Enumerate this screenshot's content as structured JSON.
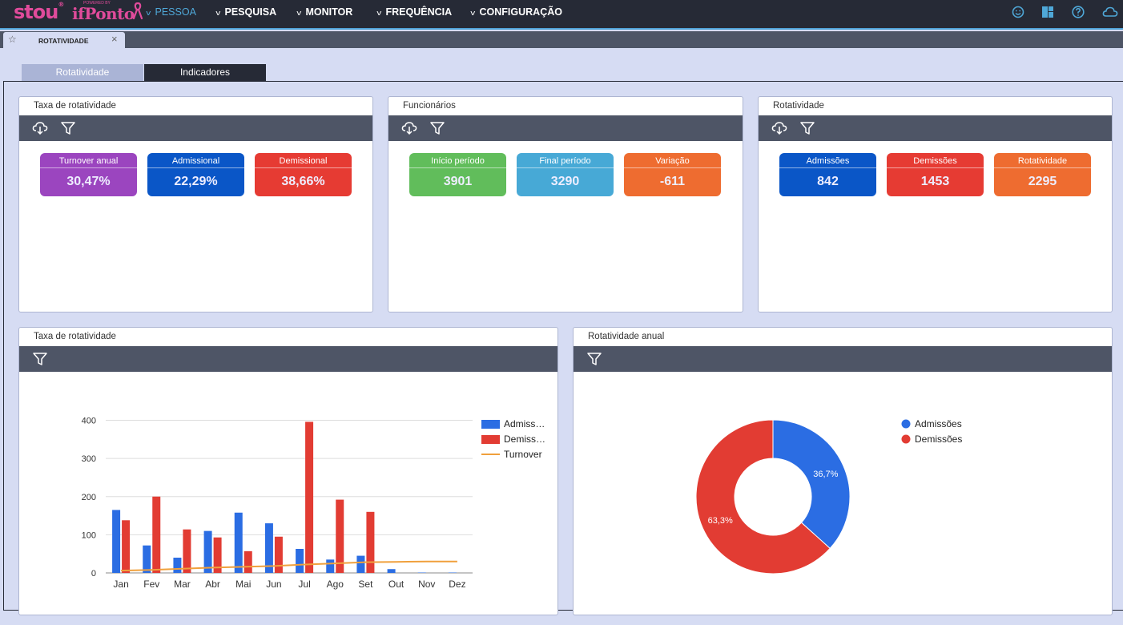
{
  "topbar": {
    "logo_main": "stou",
    "logo_sup": "®",
    "logo_powered": "POWERED BY",
    "logo_secondary": "ifPonto",
    "nav": [
      {
        "label": "PESSOA",
        "active": true
      },
      {
        "label": "PESQUISA"
      },
      {
        "label": "MONITOR"
      },
      {
        "label": "FREQUÊNCIA"
      },
      {
        "label": "CONFIGURAÇÃO"
      }
    ],
    "right_icons": [
      "smiley-icon",
      "dashboard-icon",
      "help-icon",
      "cloud-icon"
    ]
  },
  "tabs": [
    {
      "label": "ROTATIVIDADE",
      "star_icon": "star-icon",
      "close_icon": "close-icon"
    }
  ],
  "subtabs": [
    {
      "label": "Rotatividade"
    },
    {
      "label": "Indicadores",
      "active": true
    }
  ],
  "panels": {
    "taxa": {
      "title": "Taxa de rotatividade",
      "cards": [
        {
          "label": "Turnover anual",
          "value": "30,47%"
        },
        {
          "label": "Admissional",
          "value": "22,29%"
        },
        {
          "label": "Demissional",
          "value": "38,66%"
        }
      ]
    },
    "funcionarios": {
      "title": "Funcionários",
      "cards": [
        {
          "label": "Início período",
          "value": "3901"
        },
        {
          "label": "Final período",
          "value": "3290"
        },
        {
          "label": "Variação",
          "value": "-611"
        }
      ]
    },
    "rotatividade": {
      "title": "Rotatividade",
      "cards": [
        {
          "label": "Admissões",
          "value": "842"
        },
        {
          "label": "Demissões",
          "value": "1453"
        },
        {
          "label": "Rotatividade",
          "value": "2295"
        }
      ]
    },
    "chart1": {
      "title": "Taxa de rotatividade"
    },
    "chart2": {
      "title": "Rotatividade anual"
    }
  },
  "colors": {
    "admissoes": "#2b6de3",
    "demissoes": "#e23c33",
    "turnover": "#f0a03c",
    "toolbar": "#4e5566",
    "topbar": "#262a36"
  },
  "chart_data": [
    {
      "type": "bar",
      "categories": [
        "Jan",
        "Fev",
        "Mar",
        "Abr",
        "Mai",
        "Jun",
        "Jul",
        "Ago",
        "Set",
        "Out",
        "Nov",
        "Dez"
      ],
      "series": [
        {
          "name": "Admiss…",
          "type": "bar",
          "values": [
            165,
            72,
            40,
            110,
            158,
            130,
            63,
            35,
            45,
            10,
            1,
            1
          ]
        },
        {
          "name": "Demiss…",
          "type": "bar",
          "values": [
            138,
            200,
            114,
            93,
            57,
            95,
            396,
            192,
            160,
            0,
            0,
            0
          ]
        },
        {
          "name": "Turnover",
          "type": "line",
          "values": [
            6,
            8,
            11,
            14,
            16,
            18,
            22,
            25,
            28,
            29,
            30,
            30
          ]
        }
      ],
      "y_ticks": [
        0,
        100,
        200,
        300,
        400
      ],
      "ylim": [
        0,
        420
      ],
      "grid": true,
      "legend": "right"
    },
    {
      "type": "pie",
      "donut": true,
      "labels": [
        "Admissões",
        "Demissões"
      ],
      "values": [
        36.7,
        63.3
      ],
      "value_labels": [
        "36,7%",
        "63,3%"
      ],
      "legend": "right"
    }
  ]
}
